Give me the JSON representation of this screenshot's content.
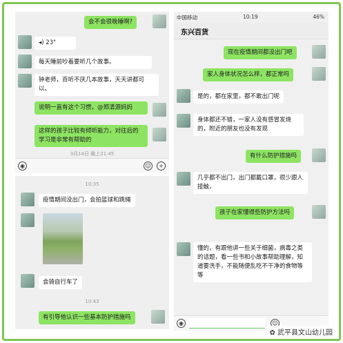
{
  "panel1": {
    "top_msg": "会不会很晚睡啊?",
    "voice": "23\"",
    "msg1": "每天睡前吵着要听几个故事。",
    "msg2": "钟老师，百听不厌几本故事，天天讲都可以。",
    "msg3": "说明一直有这个习惯，@郑清源妈妈",
    "msg4": "这样的孩子比较有倾听能力，对往后的学习是非常有帮助的",
    "date": "3月14日 晚上21:45"
  },
  "panel2": {
    "time1": "10:35",
    "msg1": "疫情期间没出门，会拍篮球和跳绳",
    "msg2": "会骑自行车了",
    "time2": "10:43",
    "msg3": "有引导他认识一些基本防护措施吗"
  },
  "panel3": {
    "carrier": "中国移动",
    "clock": "10:19",
    "battery": "46%",
    "chat_title": "东兴百货",
    "msg1": "现在疫情期间都没出门吧",
    "msg2": "家人身体状况怎么样，都正常吗",
    "msg3": "是的，都在家里，都不敢出门呢",
    "msg4": "身体都还不错，一家人没有感冒发烧的，附近的朋友也没有发现",
    "msg5": "有什么防护措施吗",
    "msg6": "几乎都不出门，出门都戴口罩，很少跟人接触，",
    "msg7": "孩子在家懂得些防护方法吗",
    "msg8": "懂的，有跟他讲一些关于细菌，病毒之类的话题，看一些书和小故事帮助理解，知道要洗手，不能随便乱吃不干净的食物等等"
  },
  "watermark": "武平县文山幼儿园"
}
